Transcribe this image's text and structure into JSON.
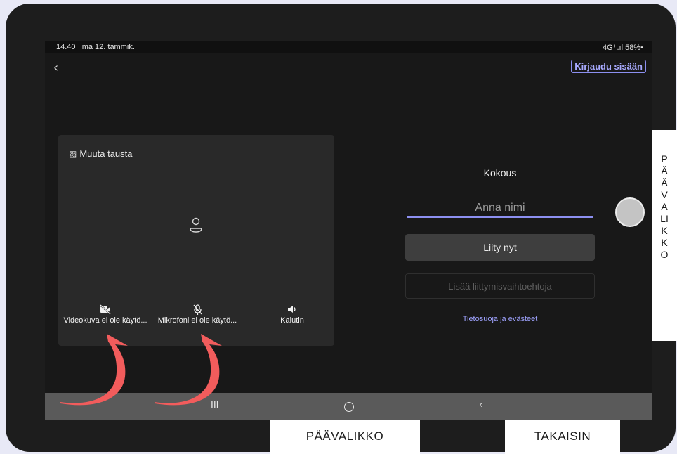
{
  "status": {
    "time": "14.40",
    "date": "ma 12. tammik.",
    "indicators": "4G⁺.ıl 58%▪"
  },
  "header": {
    "back_glyph": "‹",
    "signin_label": "Kirjaudu sisään"
  },
  "preview": {
    "background_label": "Muuta tausta",
    "controls": {
      "video_label": "Videokuva ei ole käytö...",
      "mic_label": "Mikrofoni ei ole käytö...",
      "speaker_label": "Kaiutin"
    }
  },
  "join": {
    "meeting_title": "Kokous",
    "name_placeholder": "Anna nimi",
    "join_label": "Liity nyt",
    "options_label": "Lisää liittymisvaihtoehtoja",
    "privacy_link": "Tietosuoja ja evästeet"
  },
  "navbar": {
    "recents_glyph": "III",
    "back_glyph": "‹"
  },
  "overlay": {
    "side_label": "PÄÄVALIKKO",
    "bottom_main_label": "PÄÄVALIKKO",
    "bottom_back_label": "TAKAISIN",
    "arrow_color": "#f25c5c"
  },
  "colors": {
    "accent": "#8c8ff0",
    "screen_bg": "#181818",
    "panel_bg": "#292929"
  }
}
